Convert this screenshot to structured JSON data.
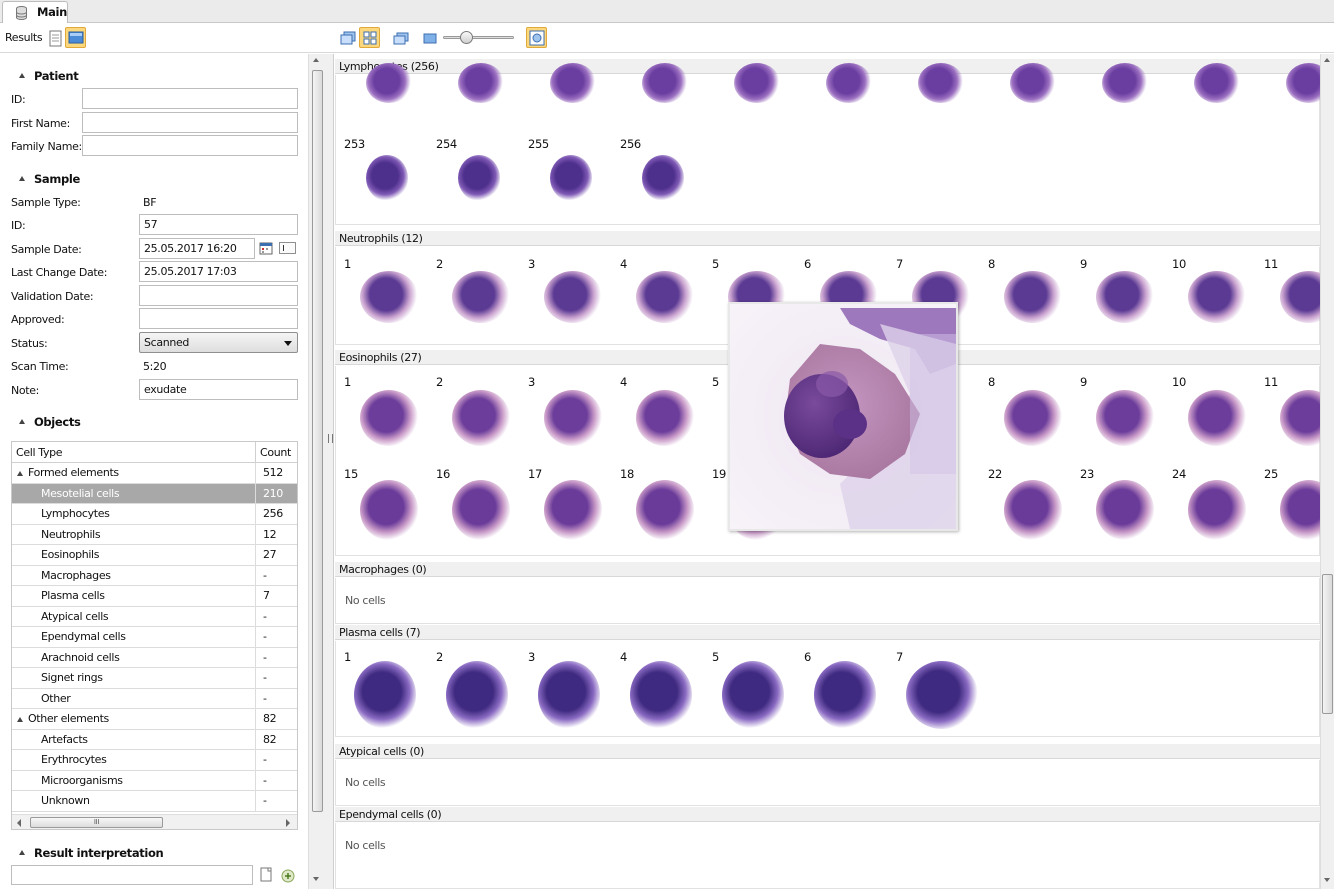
{
  "tab": {
    "label": "Main"
  },
  "toolbar": {
    "results_label": "Results"
  },
  "patient": {
    "header": "Patient",
    "id_label": "ID:",
    "id_value": "",
    "first_name_label": "First Name:",
    "first_name_value": "",
    "family_name_label": "Family Name:",
    "family_name_value": ""
  },
  "sample": {
    "header": "Sample",
    "type_label": "Sample Type:",
    "type_value": "BF",
    "id_label": "ID:",
    "id_value": "57",
    "date_label": "Sample Date:",
    "date_value": "25.05.2017 16:20",
    "change_label": "Last Change Date:",
    "change_value": "25.05.2017 17:03",
    "validation_label": "Validation Date:",
    "validation_value": "",
    "approved_label": "Approved:",
    "approved_value": "",
    "status_label": "Status:",
    "status_value": "Scanned",
    "scantime_label": "Scan Time:",
    "scantime_value": "5:20",
    "note_label": "Note:",
    "note_value": "exudate"
  },
  "objects": {
    "header": "Objects",
    "col_type": "Cell Type",
    "col_count": "Count",
    "rows": [
      {
        "name": "Formed elements",
        "count": "512"
      },
      {
        "name": "Mesotelial cells",
        "count": "210"
      },
      {
        "name": "Lymphocytes",
        "count": "256"
      },
      {
        "name": "Neutrophils",
        "count": "12"
      },
      {
        "name": "Eosinophils",
        "count": "27"
      },
      {
        "name": "Macrophages",
        "count": "-"
      },
      {
        "name": "Plasma cells",
        "count": "7"
      },
      {
        "name": "Atypical cells",
        "count": "-"
      },
      {
        "name": "Ependymal cells",
        "count": "-"
      },
      {
        "name": "Arachnoid cells",
        "count": "-"
      },
      {
        "name": "Signet rings",
        "count": "-"
      },
      {
        "name": "Other",
        "count": "-"
      },
      {
        "name": "Other elements",
        "count": "82"
      },
      {
        "name": "Artefacts",
        "count": "82"
      },
      {
        "name": "Erythrocytes",
        "count": "-"
      },
      {
        "name": "Microorganisms",
        "count": "-"
      },
      {
        "name": "Unknown",
        "count": "-"
      }
    ],
    "scroll_grip": "III"
  },
  "interpretation": {
    "header": "Result interpretation",
    "value": ""
  },
  "groups": {
    "lymphocytes": {
      "title": "Lymphocytes (256)",
      "numbers": [
        "253",
        "254",
        "255",
        "256"
      ]
    },
    "neutrophils": {
      "title": "Neutrophils (12)",
      "numbers": [
        "1",
        "2",
        "3",
        "4",
        "5",
        "6",
        "7",
        "8",
        "9",
        "10",
        "11"
      ]
    },
    "eosinophils": {
      "title": "Eosinophils (27)",
      "numbers": [
        "1",
        "2",
        "3",
        "4",
        "5",
        "",
        "",
        "8",
        "9",
        "10",
        "11"
      ],
      "numbers2": [
        "15",
        "16",
        "17",
        "18",
        "19",
        "",
        "",
        "22",
        "23",
        "24",
        "25"
      ]
    },
    "macrophages": {
      "title": "Macrophages (0)",
      "empty": "No cells"
    },
    "plasma": {
      "title": "Plasma cells (7)",
      "numbers": [
        "1",
        "2",
        "3",
        "4",
        "5",
        "6",
        "7"
      ]
    },
    "atypical": {
      "title": "Atypical cells (0)",
      "empty": "No cells"
    },
    "ependymal": {
      "title": "Ependymal cells (0)",
      "empty": "No cells"
    }
  },
  "colors": {
    "accent": "#fbd77d",
    "selected_row": "#a8a8a8",
    "cell_stain": "#6b3a9e"
  },
  "icons": [
    "database-icon",
    "report-icon",
    "image-view-icon",
    "gallery-icon",
    "grid-icon",
    "zoom-slider",
    "magnifier-icon"
  ]
}
